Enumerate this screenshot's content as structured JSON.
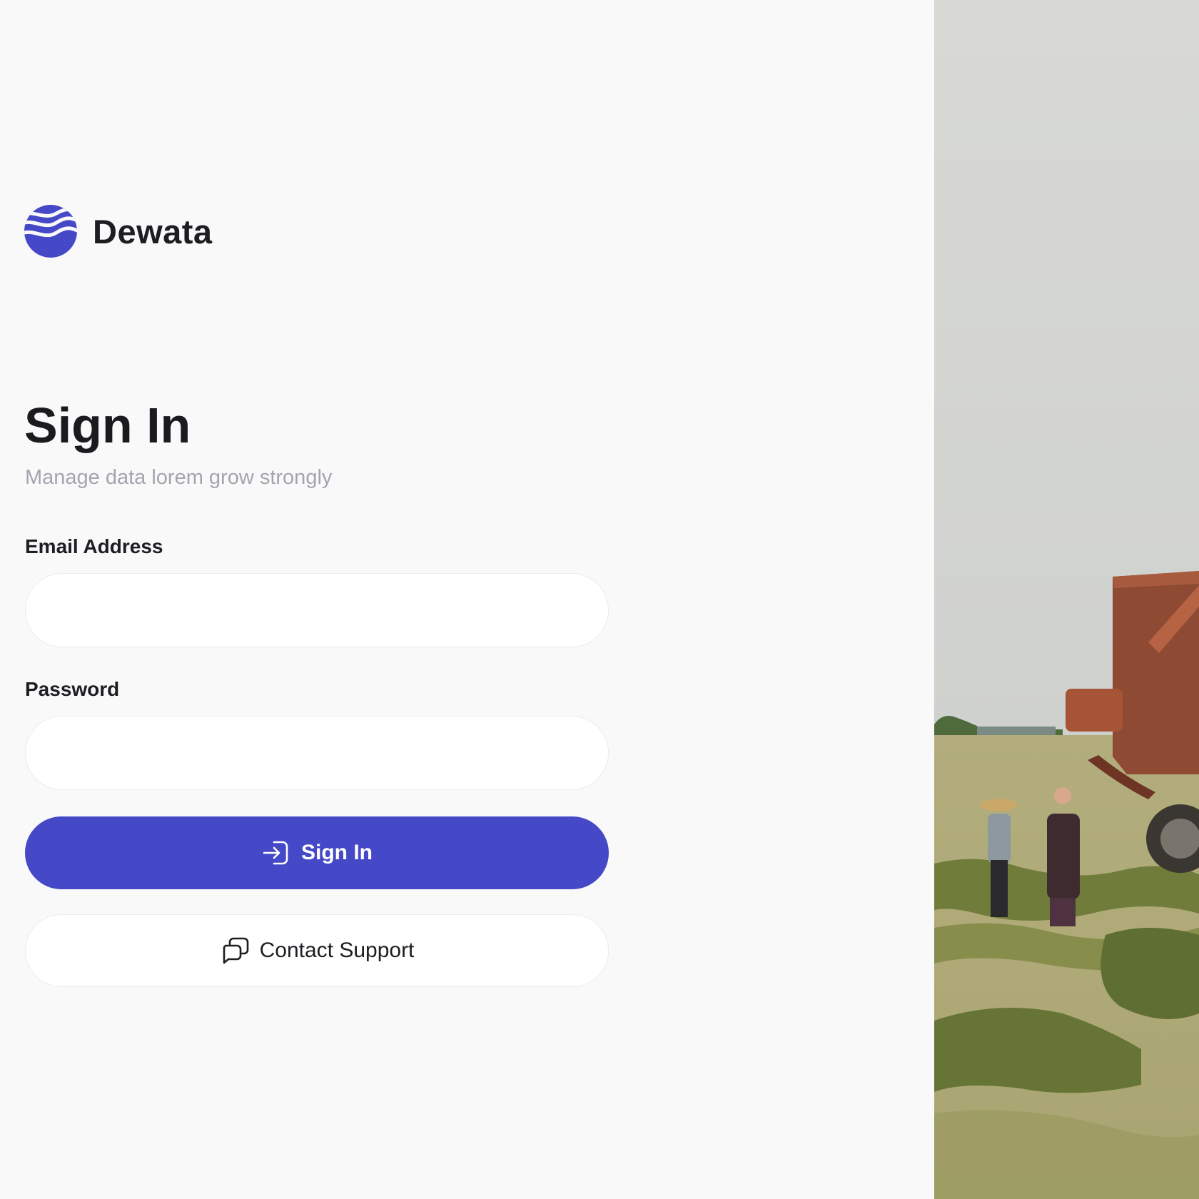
{
  "brand": {
    "name": "Dewata",
    "logo_icon": "waves-globe-icon",
    "accent_color": "#4549c7"
  },
  "signin": {
    "title": "Sign In",
    "subtitle": "Manage data lorem grow strongly",
    "email": {
      "label": "Email Address",
      "value": "",
      "placeholder": ""
    },
    "password": {
      "label": "Password",
      "value": "",
      "placeholder": ""
    },
    "submit": {
      "label": "Sign In",
      "icon": "login-arrow-icon"
    },
    "support": {
      "label": "Contact Support",
      "icon": "chat-bubbles-icon"
    }
  },
  "hero": {
    "image": "farm-field-photo",
    "icon": "photo"
  }
}
